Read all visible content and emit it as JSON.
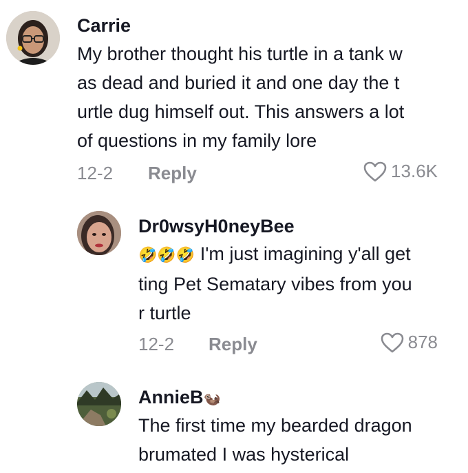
{
  "comments": [
    {
      "username": "Carrie",
      "text": "My brother thought his turtle in a tank w\nas dead and buried it and one day the t\nurtle dug himself out. This answers a lot\nof questions in my family lore",
      "date": "12-2",
      "reply_label": "Reply",
      "likes": "13.6K"
    },
    {
      "username": "Dr0wsyH0neyBee",
      "emoji_prefix": "🤣🤣🤣",
      "text": "I'm just imagining y'all get\nting Pet Sematary vibes from you\nr turtle",
      "date": "12-2",
      "reply_label": "Reply",
      "likes": "878"
    },
    {
      "username": "AnnieB",
      "username_emoji": "🦦",
      "text": "The first time my bearded dragon\nbrumated I was hysterical"
    }
  ],
  "colors": {
    "text": "#161823",
    "muted": "#8a8b91"
  }
}
